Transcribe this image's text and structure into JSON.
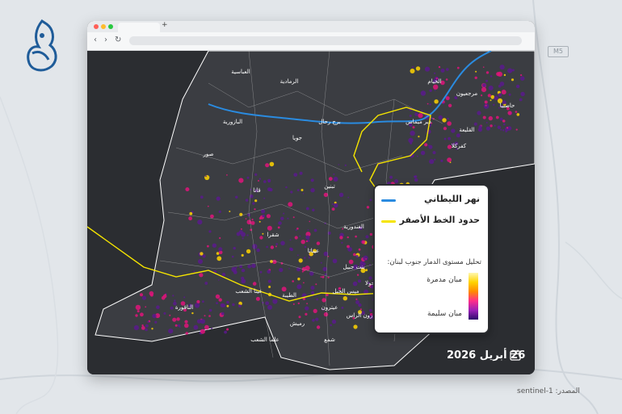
{
  "brand": {
    "logo_name": "الجزيرة"
  },
  "road_badge": "M5",
  "browser": {
    "new_tab_symbol": "+"
  },
  "map": {
    "labels": [
      "العباسية",
      "الرمادية",
      "صور",
      "قانا",
      "تبنين",
      "بنت جبيل",
      "الناقورة",
      "الخيام",
      "مرجعيون",
      "حاصبيا",
      "كفركلا",
      "عيترون",
      "الطيبة",
      "ميس الجبل",
      "عيتا الشعب",
      "رميش",
      "عيناتا",
      "شقرا",
      "دير ميماس",
      "القليعة",
      "البازورية",
      "جويا",
      "برج رحال",
      "الغندورية",
      "حولا",
      "مركبا",
      "يارون",
      "مارون الراس",
      "علما الشعب",
      "شمع"
    ],
    "colors": {
      "background": "#2b2d31",
      "land": "#3a3c41",
      "litani_river": "#2a8be0",
      "yellow_line": "#f5e400",
      "damage_low": "#5a1a8c",
      "damage_mid": "#e0147a",
      "damage_high": "#ffd400"
    }
  },
  "date": "26 أبريل 2026",
  "legend": {
    "river_label": "نهر الليطاني",
    "line_label": "حدود الخط الأصفر",
    "title": "تحليل مستوى الدمار جنوب لبنان:",
    "high_label": "مبان مدمرة",
    "low_label": "مبان سليمة"
  },
  "source": "المصدر: sentinel-1"
}
